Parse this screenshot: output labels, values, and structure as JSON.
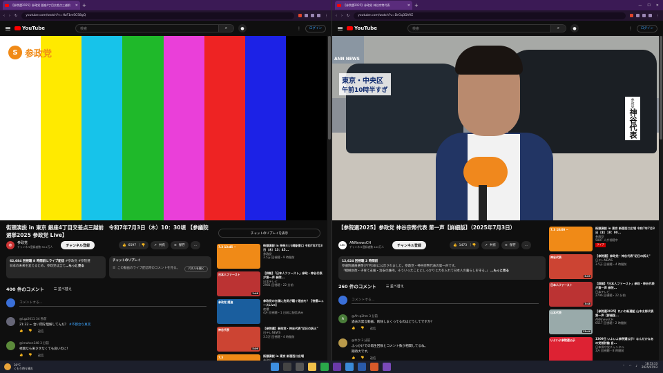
{
  "left": {
    "tab_title": "【参院選2025】参政党 銀座4丁目交差点三越前",
    "url": "youtube.com/watch?v=HzF1mSCS8gQ",
    "search_placeholder": "検索",
    "login": "ログイン",
    "brand": "YouTube",
    "logo_text": "参政党",
    "logo_mark": "S",
    "video_title": "街頭演説 in 東京 銀座4丁目交差点三越前　令和7年7月3日（木）10：30頃 【参議院選挙2025 参政党 Live】",
    "channel": {
      "name": "参政党",
      "subs": "チャンネル登録者数 30.2万人",
      "avatar": "参"
    },
    "subscribe": "チャンネル登録",
    "likes": "6597",
    "share": "共有",
    "save": "保存",
    "more": "…",
    "desc_stats": "62,684 回視聴 8 時間前にライブ配信",
    "desc_tags": "#参政党 #参院選",
    "desc_text": "日本の未来を変えるため、参政党は全て",
    "desc_more": "…もっと見る",
    "replay_head": "チャットのリプレイ",
    "replay_text": "この動画のライブ配信時のコメントを見る。",
    "replay_btn": "パネルを開く",
    "chat_replay_button": "チャットのリプレイを表示",
    "comment_count": "400 件のコメント",
    "sort": "並べ替え",
    "add_comment": "コメントする...",
    "comments": [
      {
        "user": "@Lgz2011",
        "time": "34 秒前",
        "text": "21:32 ← 合い間を理解してんだ？",
        "tag": "#不都合な真実",
        "reply": "返信",
        "color": "#667"
      },
      {
        "user": "@imuhon148",
        "time": "3 分前",
        "text": "視聴なら来させなくても良いのに！",
        "tag": "",
        "reply": "返信",
        "color": "#5b8a3a"
      }
    ],
    "recs": [
      {
        "title": "街頭演説 in 神奈川 川崎駅東口 令和7年7月3日（木）13：45...",
        "ch": "参政党",
        "meta": "3.5万 回視聴・9 時間前",
        "dur": "",
        "bg": "#f08a17",
        "label": "7.3 13:45 ~"
      },
      {
        "title": "【詳報】「日本人ファースト」参政・神谷代表が第一声 参院...",
        "ch": "日本テレビ",
        "meta": "2981 回視聴・22 分前",
        "dur": "3:48",
        "bg": "#b33",
        "label": "日本人ファースト"
      },
      {
        "title": "参政党の台頭に危気が騒ぐ理由を？【夜櫻ニュースLive】",
        "ch": "夜櫻",
        "meta": "4万 回視聴・1 日前に配信済み",
        "dur": "",
        "bg": "#1a5e9e",
        "label": "参政党 躍進"
      },
      {
        "title": "【参院選】参政党・神谷代表\"初日の訴え\"",
        "ch": "日テレNEWS",
        "meta": "3.5万 回視聴・4 時間前",
        "dur": "5:09",
        "bg": "#c43",
        "label": "神谷代表"
      },
      {
        "title": "街頭演説 in 東京 新宿西口広場",
        "ch": "参政党",
        "meta": "",
        "dur": "",
        "bg": "#f08a17",
        "label": "7.3"
      }
    ]
  },
  "right": {
    "tab_title": "【参院選2025】参政党 神谷宗幣代表",
    "url": "youtube.com/watch?v=DrGq3DVKE",
    "search_placeholder": "検索",
    "login": "ログイン",
    "brand": "YouTube",
    "news_location": "東京・中央区",
    "news_time": "午前10時半すぎ",
    "news_name_tag": "参政党",
    "news_name": "神谷代表",
    "news_logo": "ANN NEWS",
    "video_title": "【参院選2025】参政党 神谷宗幣代表 第一声【詳細版】（2025年7月3日）",
    "channel": {
      "name": "ANNnewsCH",
      "subs": "チャンネル登録者数 442万人",
      "avatar": "ANN"
    },
    "subscribe": "チャンネル登録",
    "likes": "1473",
    "share": "共有",
    "save": "保存",
    "more": "…",
    "desc_stats": "12,624 回視聴 2 時間前",
    "desc_text1": "参議院議員選挙が7月3日に公示されました。参政党・神谷宗幣代表の第一声です。",
    "desc_text2": "「積極財政・子育て支援・治安の維持。そういったことにしっかりと力を入れて日本人の暮らしを守る。」",
    "desc_more": "…もっと見る",
    "comment_count": "260 件のコメント",
    "sort": "並べ替え",
    "add_comment": "コメントする...",
    "comments": [
      {
        "user": "@Ah-q2hm",
        "time": "3 分前",
        "text": "過去の発言動画、削除しまくってるのはどうしてですか？",
        "tag": "",
        "reply": "返信",
        "color": "#4a7d3a",
        "av": "A"
      },
      {
        "user": "@ゆか",
        "time": "3 分前",
        "text": "ふっかけでの再生回数とコメント数が相関してるね。",
        "tag": "",
        "reply": "返信",
        "color": "#b99a4a",
        "av": ""
      },
      {
        "user": "",
        "time": "",
        "text": "期待大です。",
        "tag": "",
        "reply": "返信",
        "color": "#555",
        "av": ""
      }
    ],
    "recs": [
      {
        "title": "街頭演説 in 東京 新宿西口広場 令和7年7月3日（木）18：00...",
        "ch": "参政党",
        "meta": "5887 人が視聴中",
        "live": "ライブ",
        "dur": "",
        "bg": "#f08a17",
        "label": "7.3 18:00 ~"
      },
      {
        "title": "【参院選】参政党・神谷代表\"初日の訴え\"",
        "ch": "日テレNEWS",
        "meta": "3.5万 回視聴・4 時間前",
        "live": "",
        "dur": "5:09",
        "bg": "#c43",
        "label": "神谷代表"
      },
      {
        "title": "【詳報】「日本人ファースト」参政・神谷代表が第一声 参院...",
        "ch": "日本テレビ",
        "meta": "2796 回視聴・22 分前",
        "live": "",
        "dur": "3:48",
        "bg": "#b33",
        "label": "日本人ファースト"
      },
      {
        "title": "【参院選2025】れいわ新選組 山本太郎代表 第一声【詳細版...",
        "ch": "ANNnewsCH",
        "meta": "6517 回視聴・2 時間前",
        "live": "",
        "dur": "13:44",
        "bg": "#9aa",
        "label": "山本代表"
      },
      {
        "title": "1309日 いよいよ参院選公示！なんだかなあの党首討論 自...",
        "ch": "日本保守党チャンネル",
        "meta": "3万 回視聴・8 時間前",
        "live": "",
        "dur": "",
        "bg": "#d23",
        "label": "いよいよ参院選公示"
      }
    ]
  },
  "taskbar": {
    "temp": "30°C",
    "weather": "くもり時々晴れ",
    "time": "18:53:33",
    "date": "2025/07/03"
  },
  "colors": {
    "youtube_red": "#ff0000",
    "sanseito_orange": "#f08a17",
    "browser_purple": "#3b1a55"
  },
  "test_bars": [
    "#ffffff",
    "#ffea00",
    "#17c3ea",
    "#1fb92a",
    "#ea3fd9",
    "#ee2323",
    "#1c22e6",
    "#000000"
  ]
}
